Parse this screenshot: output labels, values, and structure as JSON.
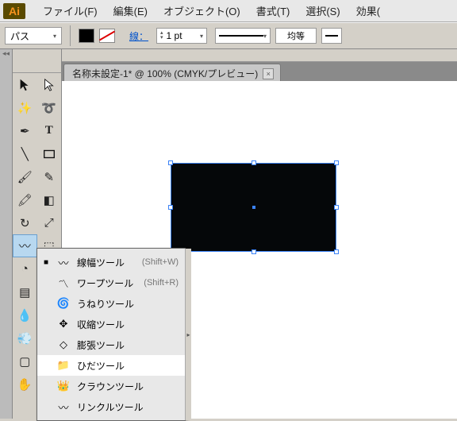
{
  "app": {
    "logo": "Ai"
  },
  "menu": {
    "file": "ファイル(F)",
    "edit": "編集(E)",
    "object": "オブジェクト(O)",
    "type": "書式(T)",
    "select": "選択(S)",
    "effect": "効果("
  },
  "options": {
    "path_label": "パス",
    "stroke_label": "線：",
    "stroke_value": "1 pt",
    "uniform": "均等"
  },
  "doc": {
    "tab_title": "名称未設定-1* @ 100% (CMYK/プレビュー)",
    "close": "×"
  },
  "flyout": {
    "items": [
      {
        "marked": true,
        "icon": "〰",
        "label": "線幅ツール",
        "shortcut": "(Shift+W)"
      },
      {
        "marked": false,
        "icon": "〽",
        "label": "ワープツール",
        "shortcut": "(Shift+R)"
      },
      {
        "marked": false,
        "icon": "🌀",
        "label": "うねりツール",
        "shortcut": ""
      },
      {
        "marked": false,
        "icon": "✥",
        "label": "収縮ツール",
        "shortcut": ""
      },
      {
        "marked": false,
        "icon": "◇",
        "label": "膨張ツール",
        "shortcut": ""
      },
      {
        "marked": false,
        "icon": "📁",
        "label": "ひだツール",
        "shortcut": "",
        "selected": true
      },
      {
        "marked": false,
        "icon": "👑",
        "label": "クラウンツール",
        "shortcut": ""
      },
      {
        "marked": false,
        "icon": "〰",
        "label": "リンクルツール",
        "shortcut": ""
      }
    ]
  }
}
